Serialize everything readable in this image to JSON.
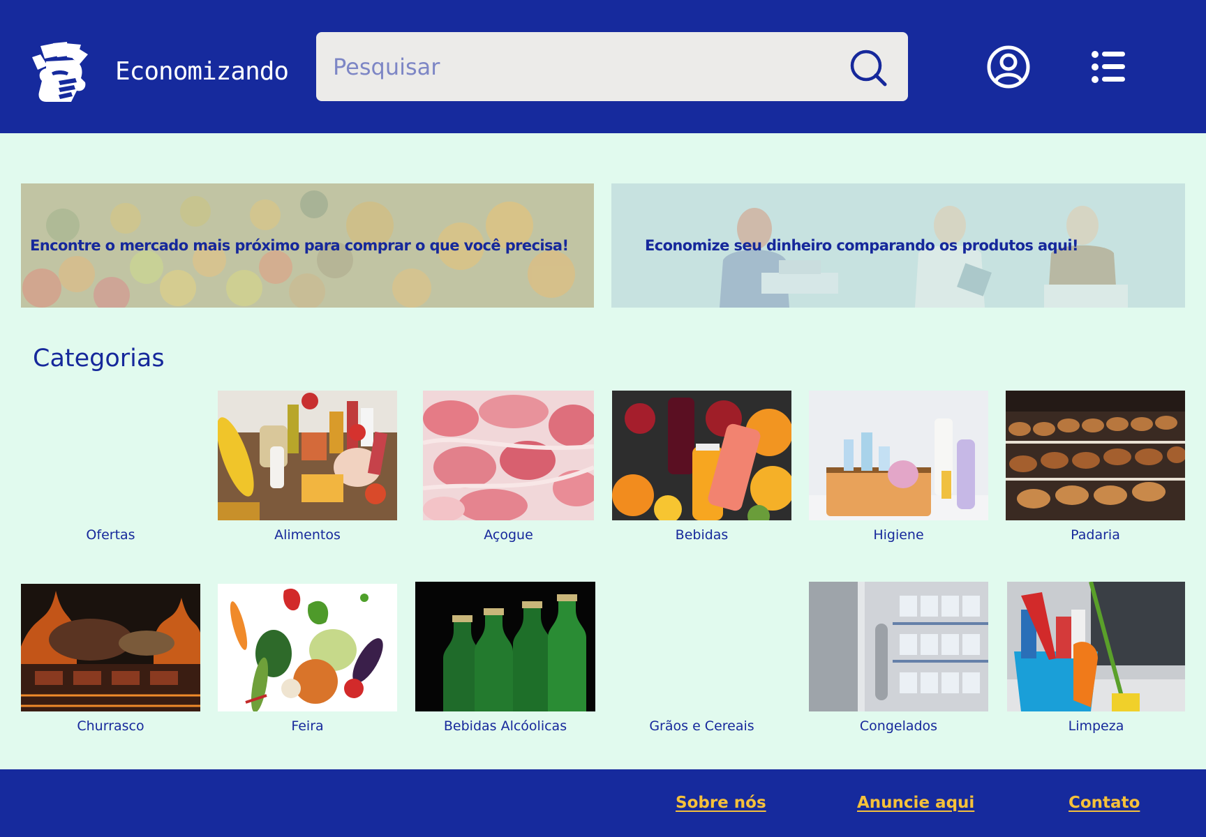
{
  "header": {
    "brand": "Economizando",
    "search_placeholder": "Pesquisar",
    "search_icon": "search-icon",
    "account_icon": "user-circle-icon",
    "menu_icon": "list-menu-icon",
    "colors": {
      "background": "#162a9d",
      "search_bg": "#ecebe9"
    }
  },
  "banners": [
    {
      "text": "Encontre o mercado mais próximo para comprar o que você precisa!"
    },
    {
      "text": "Economize seu dinheiro comparando os produtos aqui!"
    }
  ],
  "categories": {
    "title": "Categorias",
    "items": [
      {
        "label": "Ofertas"
      },
      {
        "label": "Alimentos"
      },
      {
        "label": "Açogue"
      },
      {
        "label": "Bebidas"
      },
      {
        "label": "Higiene"
      },
      {
        "label": "Padaria"
      },
      {
        "label": "Churrasco"
      },
      {
        "label": "Feira"
      },
      {
        "label": "Bebidas Alcóolicas"
      },
      {
        "label": "Grãos e Cereais"
      },
      {
        "label": "Congelados"
      },
      {
        "label": "Limpeza"
      }
    ]
  },
  "footer": {
    "links": [
      {
        "label": "Sobre nós"
      },
      {
        "label": "Anuncie aqui"
      },
      {
        "label": "Contato"
      }
    ],
    "colors": {
      "link": "#f6c13a",
      "background": "#162a9d"
    }
  },
  "colors": {
    "page_bg": "#e1faee",
    "text": "#16289b"
  }
}
